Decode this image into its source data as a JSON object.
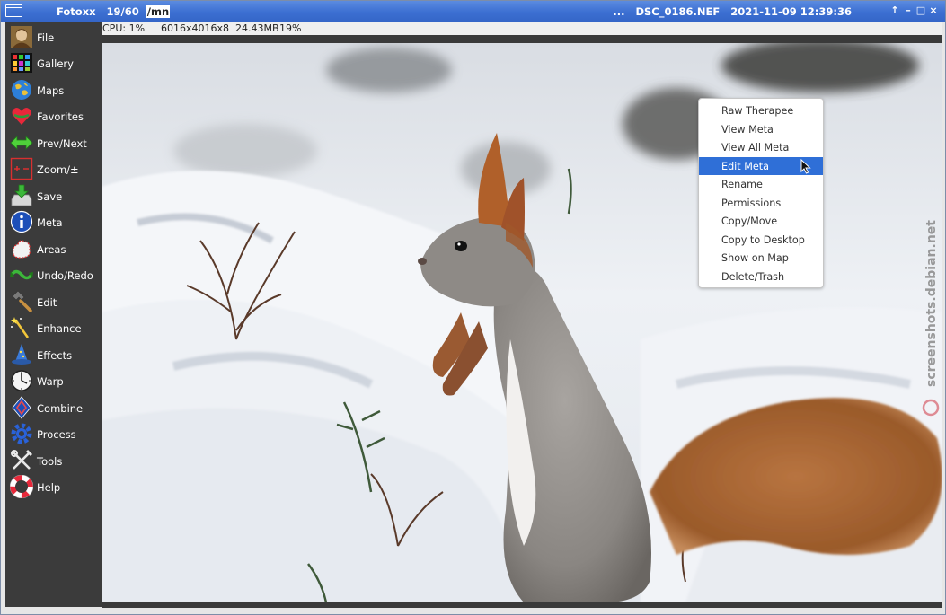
{
  "window": {
    "app_name": "Fotoxx",
    "image_count": "19/60",
    "path": "/mn",
    "title_ellipsis": "...",
    "file_name": "DSC_0186.NEF",
    "datetime": "2021-11-09 12:39:36",
    "controls": {
      "up": "↑",
      "minimize": "–",
      "maximize": "□",
      "close": "×"
    }
  },
  "status": {
    "cpu": "CPU: 1%",
    "dimensions": "6016x4016x8",
    "file_size": "24.43MB",
    "zoom": "19%"
  },
  "sidebar": {
    "items": [
      {
        "label": "File",
        "icon": "portrait-icon"
      },
      {
        "label": "Gallery",
        "icon": "gallery-grid-icon"
      },
      {
        "label": "Maps",
        "icon": "globe-icon"
      },
      {
        "label": "Favorites",
        "icon": "heart-icon"
      },
      {
        "label": "Prev/Next",
        "icon": "double-arrow-icon"
      },
      {
        "label": "Zoom/±",
        "icon": "zoom-plus-minus-icon"
      },
      {
        "label": "Save",
        "icon": "download-tray-icon"
      },
      {
        "label": "Meta",
        "icon": "info-icon"
      },
      {
        "label": "Areas",
        "icon": "lasso-area-icon"
      },
      {
        "label": "Undo/Redo",
        "icon": "undo-redo-icon"
      },
      {
        "label": "Edit",
        "icon": "hammer-icon"
      },
      {
        "label": "Enhance",
        "icon": "magic-wand-icon"
      },
      {
        "label": "Effects",
        "icon": "wizard-hat-icon"
      },
      {
        "label": "Warp",
        "icon": "clock-icon"
      },
      {
        "label": "Combine",
        "icon": "combine-icon"
      },
      {
        "label": "Process",
        "icon": "gear-icon"
      },
      {
        "label": "Tools",
        "icon": "tools-icon"
      },
      {
        "label": "Help",
        "icon": "lifebuoy-icon"
      }
    ]
  },
  "context_menu": {
    "items": [
      "Raw Therapee",
      "View Meta",
      "View All Meta",
      "Edit Meta",
      "Rename",
      "Permissions",
      "Copy/Move",
      "Copy to Desktop",
      "Show on Map",
      "Delete/Trash"
    ],
    "highlighted": "Edit Meta"
  },
  "watermark": {
    "text": "screenshots.debian.net"
  },
  "colors": {
    "titlebar": "#3c6fd2",
    "sidebar": "#3b3b3b",
    "menu_highlight": "#2f6fd7",
    "snow": "#e9edf2",
    "squirrel_fur": "#8a8682",
    "squirrel_tail": "#b06a38"
  }
}
